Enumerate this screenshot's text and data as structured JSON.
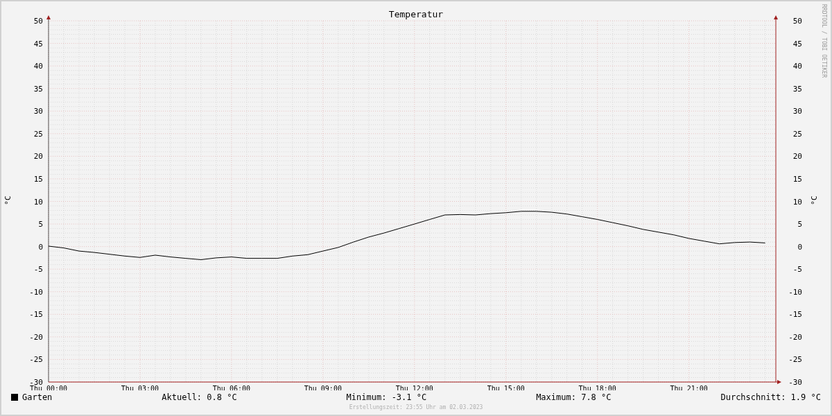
{
  "chart": {
    "chart_data": {
      "type": "line",
      "title": "Temperatur",
      "ylabel": "°C",
      "categories": [
        "Thu 00:00",
        null,
        null,
        null,
        null,
        null,
        "Thu 03:00",
        null,
        null,
        null,
        null,
        null,
        "Thu 06:00",
        null,
        null,
        null,
        null,
        null,
        "Thu 09:00",
        null,
        null,
        null,
        null,
        null,
        "Thu 12:00",
        null,
        null,
        null,
        null,
        null,
        "Thu 15:00",
        null,
        null,
        null,
        null,
        null,
        "Thu 18:00",
        null,
        null,
        null,
        null,
        null,
        "Thu 21:00",
        null,
        null,
        null,
        null,
        null
      ],
      "series": [
        {
          "name": "Garten",
          "color": "#000000",
          "values": [
            0.1,
            -0.3,
            -1.0,
            -1.3,
            -1.7,
            -2.1,
            -2.4,
            -1.9,
            -2.3,
            -2.6,
            -2.9,
            -2.5,
            -2.3,
            -2.6,
            -2.6,
            -2.6,
            -2.1,
            -1.8,
            -1.0,
            -0.2,
            1.0,
            2.1,
            3.0,
            4.0,
            5.0,
            6.0,
            7.0,
            7.1,
            7.0,
            7.3,
            7.5,
            7.8,
            7.8,
            7.6,
            7.2,
            6.6,
            6.0,
            5.3,
            4.6,
            3.8,
            3.2,
            2.6,
            1.8,
            1.2,
            0.6,
            0.9,
            1.0,
            0.8
          ]
        }
      ],
      "ylim": [
        -30,
        50
      ],
      "grid": true,
      "yticks": [
        -30,
        -25,
        -20,
        -15,
        -10,
        -5,
        0,
        5,
        10,
        15,
        20,
        25,
        30,
        35,
        40,
        45,
        50
      ]
    },
    "right_axis_label": "°C",
    "right_yticks": [
      "50",
      "45",
      "40",
      "35",
      "30",
      "25",
      "20",
      "15",
      "10",
      "5",
      "0",
      "-5",
      "-10",
      "-15",
      "-20",
      "-25",
      "-30"
    ],
    "credit": "RRDTOOL / TOBI OETIKER"
  },
  "legend": {
    "stats": [
      "Aktuell: 0.8 °C",
      "Minimum: -3.1 °C",
      "Maximum: 7.8 °C",
      "Durchschnitt: 1.9 °C"
    ]
  },
  "footer": "Erstellungszeit: 23:55 Uhr am 02.03.2023"
}
